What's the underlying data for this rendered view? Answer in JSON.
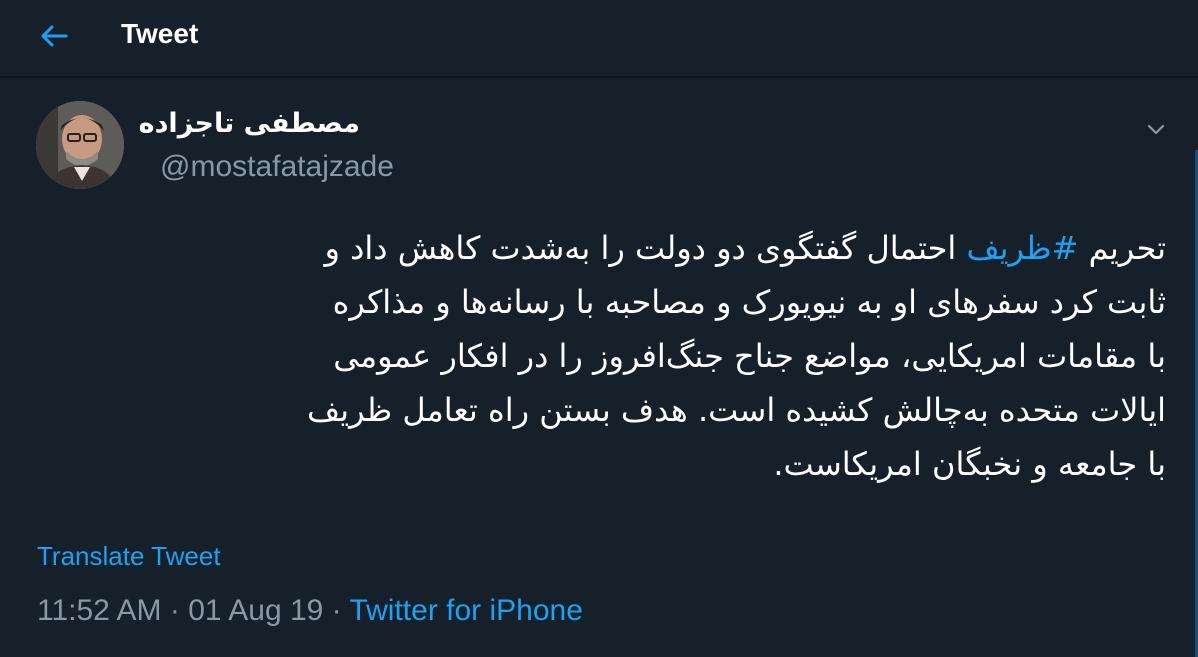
{
  "header": {
    "title": "Tweet",
    "back_icon": "arrow-left-icon",
    "accent": "#1da1f2"
  },
  "tweet": {
    "author": {
      "display_name": "مصطفی تاجزاده",
      "handle": "@mostafatajzade"
    },
    "body": {
      "line1_start": "تحریم ",
      "hashtag": "#ظریف",
      "line1_end": " احتمال گفتگوی دو دولت را به‌شدت کاهش داد و",
      "line2": "ثابت کرد سفرهای او به نیویورک و مصاحبه با رسانه‌ها و مذاکره",
      "line3": "با مقامات امریکایی، مواضع جناح جنگ‌افروز را در افکار عمومی",
      "line4": "ایالات متحده به‌چالش کشیده است. هدف بستن راه تعامل ظریف",
      "line5": "با جامعه و نخبگان امریکاست."
    },
    "translate_label": "Translate Tweet",
    "time": "11:52 AM",
    "date": "01 Aug 19",
    "separator": " · ",
    "source": "Twitter for iPhone",
    "more_icon": "chevron-down-icon"
  },
  "colors": {
    "background": "#15202b",
    "secondary_text": "#8899a6",
    "link": "#1da1f2"
  }
}
